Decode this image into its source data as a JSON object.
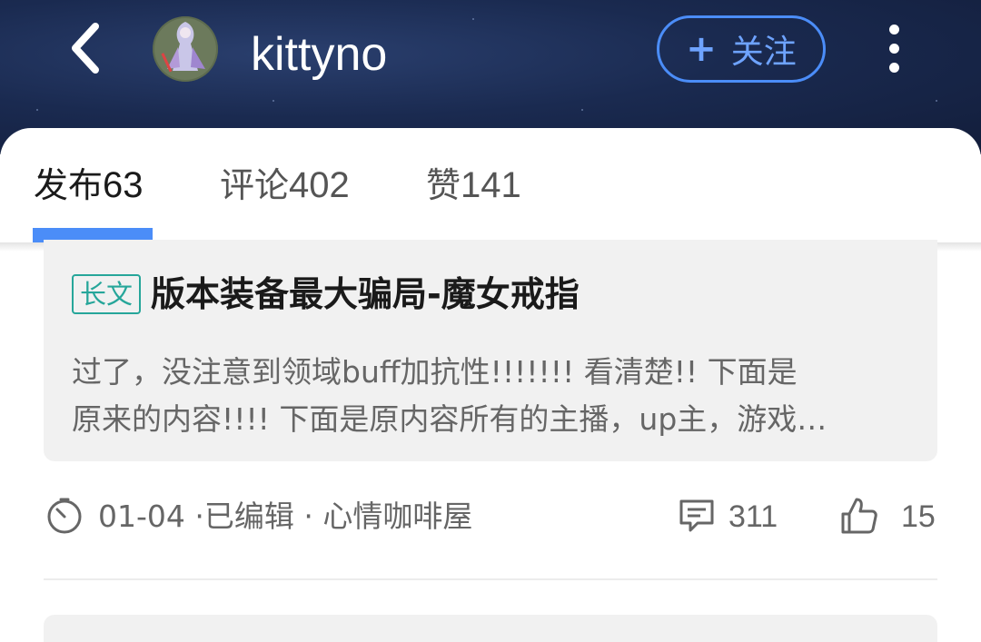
{
  "header": {
    "username": "kittyno",
    "follow_label": "关注",
    "follow_plus": "+"
  },
  "icons": {
    "back": "back-arrow-icon",
    "more": "more-vertical-icon",
    "clock": "clock-icon",
    "comment": "comment-icon",
    "like": "thumbs-up-icon"
  },
  "tabs": [
    {
      "label": "发布",
      "count": "63",
      "active": true
    },
    {
      "label": "评论",
      "count": "402",
      "active": false
    },
    {
      "label": "赞",
      "count": "141",
      "active": false
    }
  ],
  "post": {
    "badge": "长文",
    "title": "版本装备最大骗局-魔女戒指",
    "excerpt_line1": "过了，没注意到领域buff加抗性!!!!!!!  看清楚!!  下面是",
    "excerpt_line2": "原来的内容!!!!  下面是原内容所有的主播，up主，游戏…",
    "meta": "01-04 ·已编辑  ·  心情咖啡屋",
    "comments": "311",
    "likes": "15"
  },
  "colors": {
    "accent": "#4b8df8",
    "badge": "#26a69a",
    "header_bg": "#1a2a50"
  }
}
